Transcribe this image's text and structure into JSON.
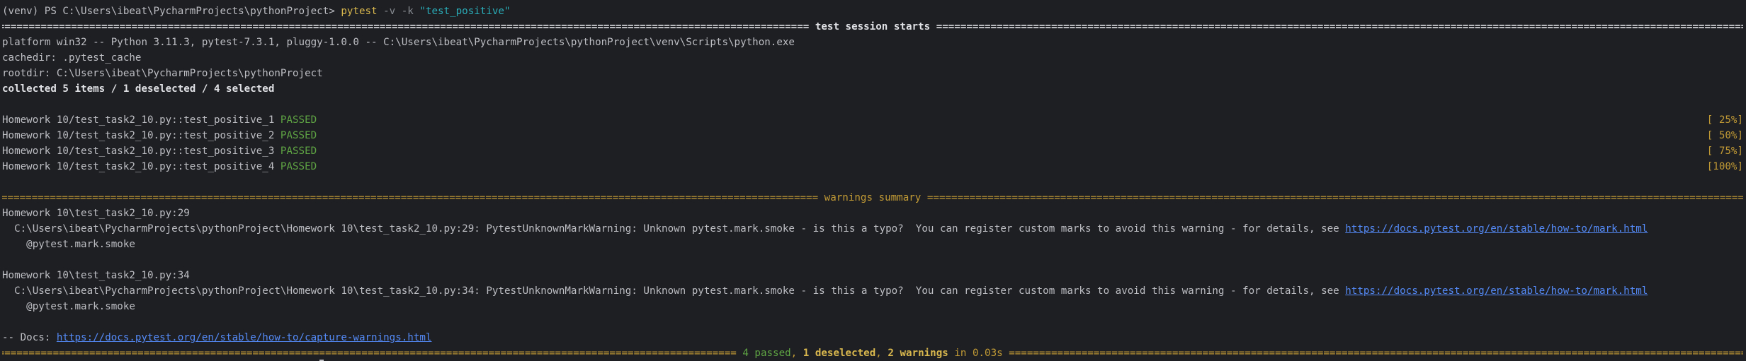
{
  "prompt": {
    "prefix": "(venv) PS C:\\Users\\ibeat\\PycharmProjects\\pythonProject> ",
    "command": "pytest",
    "flag_v": " -v",
    "flag_k": " -k",
    "arg": " \"test_positive\""
  },
  "session_header": {
    "title": " test session starts "
  },
  "info": {
    "platform": "platform win32 -- Python 3.11.3, pytest-7.3.1, pluggy-1.0.0 -- C:\\Users\\ibeat\\PycharmProjects\\pythonProject\\venv\\Scripts\\python.exe",
    "cachedir": "cachedir: .pytest_cache",
    "rootdir": "rootdir: C:\\Users\\ibeat\\PycharmProjects\\pythonProject",
    "collected": "collected 5 items / 1 deselected / 4 selected"
  },
  "tests": [
    {
      "name": "Homework 10/test_task2_10.py::test_positive_1 ",
      "status": "PASSED",
      "progress": "[ 25%]"
    },
    {
      "name": "Homework 10/test_task2_10.py::test_positive_2 ",
      "status": "PASSED",
      "progress": "[ 50%]"
    },
    {
      "name": "Homework 10/test_task2_10.py::test_positive_3 ",
      "status": "PASSED",
      "progress": "[ 75%]"
    },
    {
      "name": "Homework 10/test_task2_10.py::test_positive_4 ",
      "status": "PASSED",
      "progress": "[100%]"
    }
  ],
  "warnings_header": {
    "title": " warnings summary "
  },
  "warnings": [
    {
      "location": "Homework 10\\test_task2_10.py:29",
      "message": "  C:\\Users\\ibeat\\PycharmProjects\\pythonProject\\Homework 10\\test_task2_10.py:29: PytestUnknownMarkWarning: Unknown pytest.mark.smoke - is this a typo?  You can register custom marks to avoid this warning - for details, see ",
      "link": "https://docs.pytest.org/en/stable/how-to/mark.html",
      "decorator": "    @pytest.mark.smoke"
    },
    {
      "location": "Homework 10\\test_task2_10.py:34",
      "message": "  C:\\Users\\ibeat\\PycharmProjects\\pythonProject\\Homework 10\\test_task2_10.py:34: PytestUnknownMarkWarning: Unknown pytest.mark.smoke - is this a typo?  You can register custom marks to avoid this warning - for details, see ",
      "link": "https://docs.pytest.org/en/stable/how-to/mark.html",
      "decorator": "    @pytest.mark.smoke"
    }
  ],
  "docs": {
    "prefix": "-- Docs: ",
    "link": "https://docs.pytest.org/en/stable/how-to/capture-warnings.html"
  },
  "summary": {
    "passed": " 4 passed",
    "sep1": ", ",
    "deselected": "1 deselected",
    "sep2": ", ",
    "warnings": "2 warnings",
    "time": " in 0.03s "
  },
  "colors": {
    "background": "#1e1f22",
    "text": "#bcbec4",
    "passed": "#5fa444",
    "warning": "#c19a36",
    "command": "#d8b74e",
    "link": "#548af7",
    "string": "#2aacb8"
  }
}
